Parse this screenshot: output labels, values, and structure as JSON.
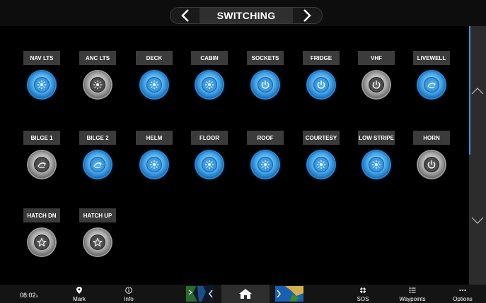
{
  "header": {
    "title": "SWITCHING",
    "prev_icon": "chevron-left-icon",
    "next_icon": "chevron-right-icon"
  },
  "colors": {
    "on": "#2a86d4",
    "off": "#9a9a9a",
    "label_bg": "#3b3b3b",
    "scroll_accent": "#3a8ed6"
  },
  "switches": [
    {
      "label": "NAV LTS",
      "state": "on",
      "icon": "light-icon"
    },
    {
      "label": "ANC LTS",
      "state": "off",
      "icon": "light-icon"
    },
    {
      "label": "DECK",
      "state": "on",
      "icon": "light-icon"
    },
    {
      "label": "CABIN",
      "state": "on",
      "icon": "light-icon"
    },
    {
      "label": "SOCKETS",
      "state": "on",
      "icon": "power-icon"
    },
    {
      "label": "FRIDGE",
      "state": "on",
      "icon": "power-icon"
    },
    {
      "label": "VHF",
      "state": "off",
      "icon": "power-icon"
    },
    {
      "label": "LIVEWELL",
      "state": "on",
      "icon": "pump-icon"
    },
    {
      "label": "BILGE 1",
      "state": "off",
      "icon": "pump-icon"
    },
    {
      "label": "BILGE 2",
      "state": "on",
      "icon": "pump-icon"
    },
    {
      "label": "HELM",
      "state": "on",
      "icon": "light-icon"
    },
    {
      "label": "FLOOR",
      "state": "on",
      "icon": "light-icon"
    },
    {
      "label": "ROOF",
      "state": "on",
      "icon": "light-icon"
    },
    {
      "label": "COURTESY",
      "state": "on",
      "icon": "light-icon"
    },
    {
      "label": "LOW STRIPE",
      "state": "on",
      "icon": "light-icon"
    },
    {
      "label": "HORN",
      "state": "off",
      "icon": "power-icon"
    },
    {
      "label": "HATCH DN",
      "state": "off",
      "icon": "star-icon"
    },
    {
      "label": "HATCH UP",
      "state": "off",
      "icon": "star-icon"
    }
  ],
  "scroller": {
    "up_icon": "chevron-up-icon",
    "down_icon": "chevron-down-icon"
  },
  "bottom_bar": {
    "time": "08:02",
    "time_suffix": "a",
    "mark_label": "Mark",
    "info_label": "Info",
    "sos_label": "SOS",
    "waypoints_label": "Waypoints",
    "options_label": "Options",
    "home_icon": "home-icon"
  }
}
